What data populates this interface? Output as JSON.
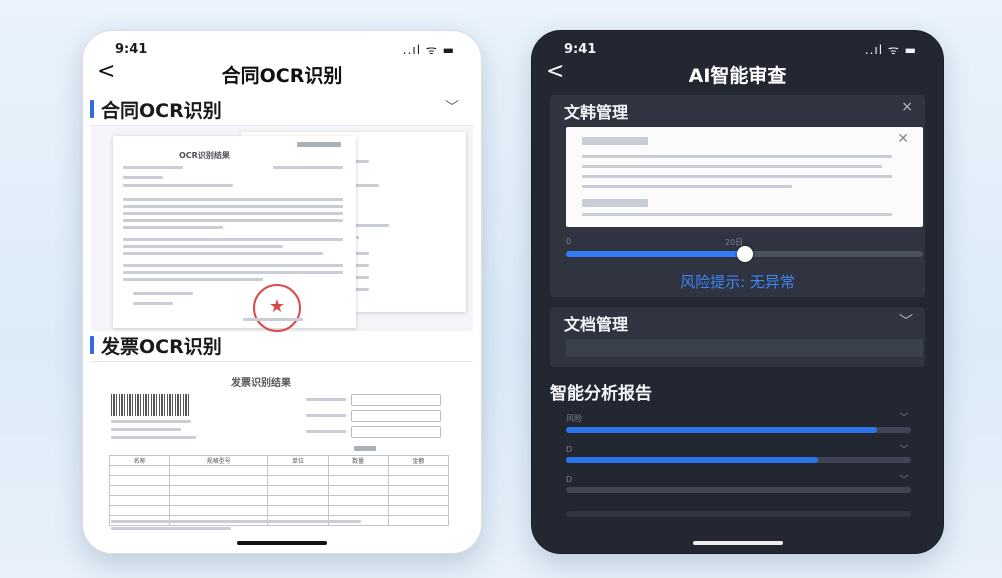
{
  "left_phone": {
    "status": {
      "time": "9:41",
      "icons": "..ıl ᯤ ▬"
    },
    "nav": {
      "back": "<",
      "title": "合同OCR识别"
    },
    "sections": [
      {
        "label": "合同OCR识别",
        "toggle": "﹀"
      },
      {
        "label": "发票OCR识别"
      }
    ],
    "contract_paper_title": "OCR识别结果",
    "invoice_title": "发票识别结果",
    "invoice_table_headers": [
      "名称",
      "规格型号",
      "单位",
      "数量",
      "金额"
    ]
  },
  "right_phone": {
    "status": {
      "time": "9:41",
      "icons": "..ıl ᯤ ▬"
    },
    "nav": {
      "back": "<",
      "title": "AI智能审查"
    },
    "doc_panel": {
      "title": "文韩管理",
      "close": "×",
      "preview_close": "✕"
    },
    "slider": {
      "left_label": "0",
      "mid_label": "20日",
      "value_fraction": 0.5
    },
    "risk_text": "风险提示: 无异常",
    "doc_panel2": {
      "title": "文档管理",
      "toggle": "﹀"
    },
    "report": {
      "title": "智能分析报告",
      "bars": [
        {
          "label": "风险",
          "fraction": 0.9
        },
        {
          "label": "D",
          "fraction": 0.73
        },
        {
          "label": "D",
          "fraction": 0.0
        }
      ]
    }
  }
}
